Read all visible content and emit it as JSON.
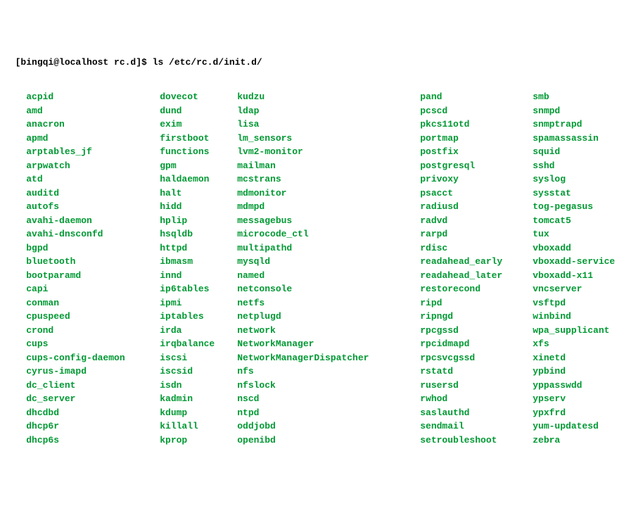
{
  "prompt": "[bingqi@localhost rc.d]$ ",
  "command": "ls /etc/rc.d/init.d/",
  "columns": [
    [
      "acpid",
      "amd",
      "anacron",
      "apmd",
      "arptables_jf",
      "arpwatch",
      "atd",
      "auditd",
      "autofs",
      "avahi-daemon",
      "avahi-dnsconfd",
      "bgpd",
      "bluetooth",
      "bootparamd",
      "capi",
      "conman",
      "cpuspeed",
      "crond",
      "cups",
      "cups-config-daemon",
      "cyrus-imapd",
      "dc_client",
      "dc_server",
      "dhcdbd",
      "dhcp6r",
      "dhcp6s"
    ],
    [
      "dovecot",
      "dund",
      "exim",
      "firstboot",
      "functions",
      "gpm",
      "haldaemon",
      "halt",
      "hidd",
      "hplip",
      "hsqldb",
      "httpd",
      "ibmasm",
      "innd",
      "ip6tables",
      "ipmi",
      "iptables",
      "irda",
      "irqbalance",
      "iscsi",
      "iscsid",
      "isdn",
      "kadmin",
      "kdump",
      "killall",
      "kprop"
    ],
    [
      "kudzu",
      "ldap",
      "lisa",
      "lm_sensors",
      "lvm2-monitor",
      "mailman",
      "mcstrans",
      "mdmonitor",
      "mdmpd",
      "messagebus",
      "microcode_ctl",
      "multipathd",
      "mysqld",
      "named",
      "netconsole",
      "netfs",
      "netplugd",
      "network",
      "NetworkManager",
      "NetworkManagerDispatcher",
      "nfs",
      "nfslock",
      "nscd",
      "ntpd",
      "oddjobd",
      "openibd"
    ],
    [
      "pand",
      "pcscd",
      "pkcs11otd",
      "portmap",
      "postfix",
      "postgresql",
      "privoxy",
      "psacct",
      "radiusd",
      "radvd",
      "rarpd",
      "rdisc",
      "readahead_early",
      "readahead_later",
      "restorecond",
      "ripd",
      "ripngd",
      "rpcgssd",
      "rpcidmapd",
      "rpcsvcgssd",
      "rstatd",
      "rusersd",
      "rwhod",
      "saslauthd",
      "sendmail",
      "setroubleshoot"
    ],
    [
      "smb",
      "snmpd",
      "snmptrapd",
      "spamassassin",
      "squid",
      "sshd",
      "syslog",
      "sysstat",
      "tog-pegasus",
      "tomcat5",
      "tux",
      "vboxadd",
      "vboxadd-service",
      "vboxadd-x11",
      "vncserver",
      "vsftpd",
      "winbind",
      "wpa_supplicant",
      "xfs",
      "xinetd",
      "ypbind",
      "yppasswdd",
      "ypserv",
      "ypxfrd",
      "yum-updatesd",
      "zebra"
    ]
  ]
}
